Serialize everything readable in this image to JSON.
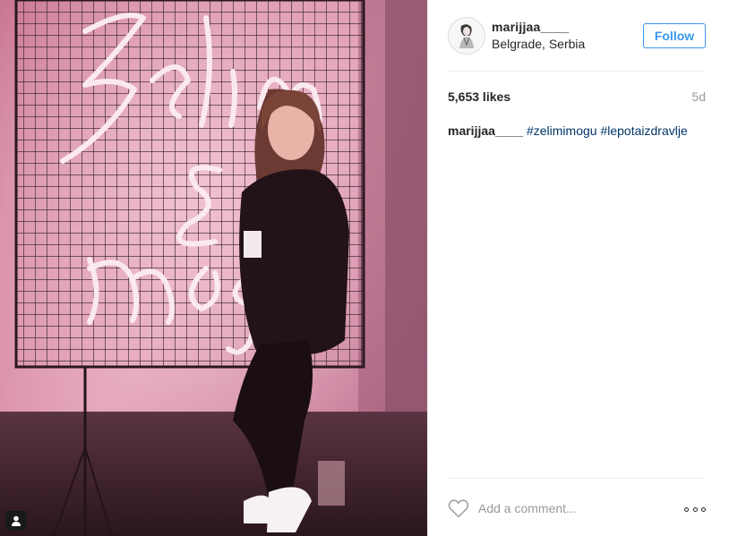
{
  "post": {
    "username": "marijjaa____",
    "location": "Belgrade, Serbia",
    "follow_label": "Follow",
    "likes": "5,653 likes",
    "age": "5d",
    "caption": {
      "username": "marijjaa____",
      "hashtags": [
        "#zelimimogu",
        "#lepotaizdravlje"
      ]
    },
    "comment_placeholder": "Add a comment...",
    "icons": {
      "like": "heart-outline-icon",
      "more": "ellipsis-icon",
      "tagged_user": "user-tag-icon"
    }
  },
  "colors": {
    "accent": "#3897f0",
    "hashtag": "#003569",
    "muted_text": "#999999",
    "text": "#262626",
    "neon": "#fbe9f0",
    "wall_pink": "#d98aa5"
  }
}
